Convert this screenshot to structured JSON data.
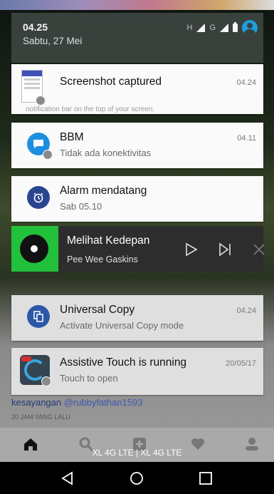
{
  "status": {
    "time": "04.25",
    "date": "Sabtu, 27 Mei",
    "net1": "H",
    "net2": "G"
  },
  "notifications": [
    {
      "title": "Screenshot captured",
      "time": "04.24",
      "hidden_text": "notification bar on the top of your screen."
    },
    {
      "title": "BBM",
      "subtitle": "Tidak ada konektivitas",
      "time": "04.11"
    },
    {
      "title": "Alarm mendatang",
      "subtitle": "Sab 05.10"
    },
    {
      "title": "Universal Copy",
      "subtitle": "Activate Universal Copy mode",
      "time": "04.24"
    },
    {
      "title": "Assistive Touch is running",
      "subtitle": "Touch to open",
      "time": "20/05/17"
    }
  ],
  "music": {
    "title": "Melihat Kedepan",
    "artist": "Pee Wee Gaskins"
  },
  "background": {
    "caption_prefix": "kesayangan ",
    "caption_handle": "@rubbyfathan1593",
    "time_ago": "20 JAM YANG LALU"
  },
  "carrier_text": "XL 4G LTE | XL 4G LTE",
  "colors": {
    "bbm": "#1e8fe0",
    "alarm": "#2a4590",
    "universal_copy": "#2b57a8",
    "music_album": "#22c13b"
  }
}
